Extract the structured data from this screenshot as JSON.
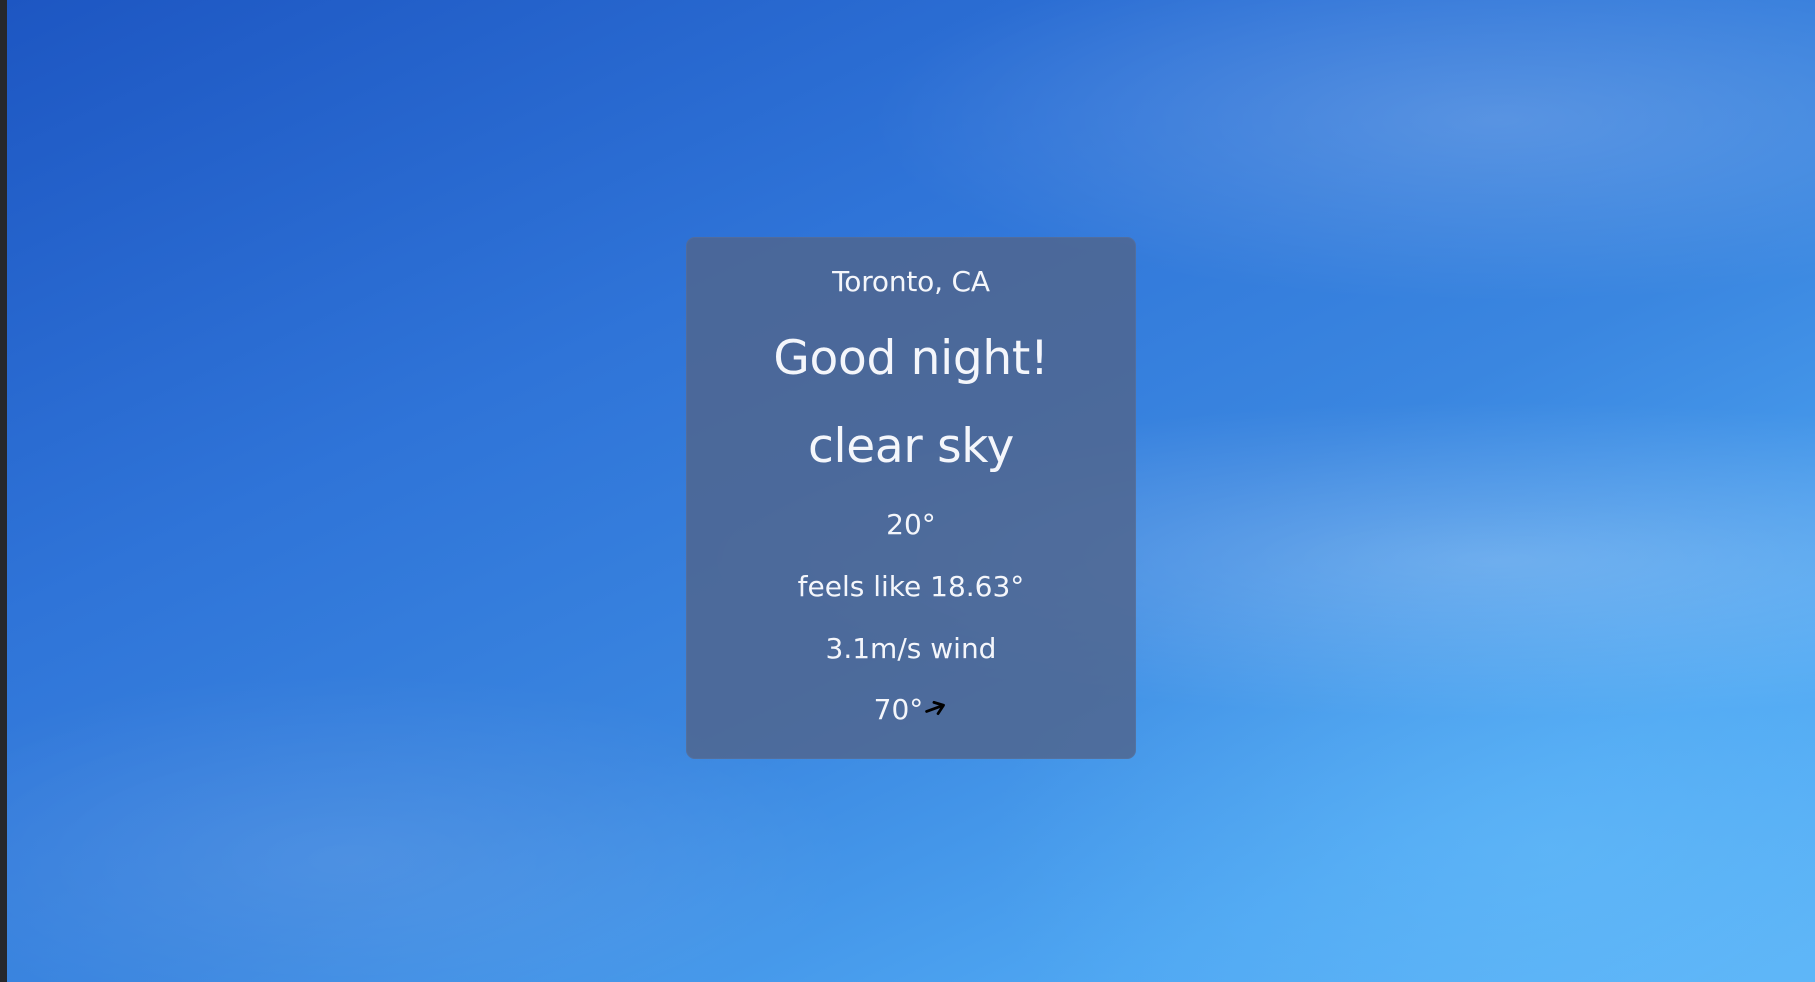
{
  "background": {
    "theme": "sky",
    "accent_colors": [
      "#1d56c2",
      "#3a86e0",
      "#5bb3f7"
    ]
  },
  "card": {
    "background_color": "#50658e",
    "location": "Toronto, CA",
    "greeting": "Good night!",
    "description": "clear sky",
    "temperature": "20°",
    "feels_like": "feels like 18.63°",
    "wind_speed": "3.1m/s wind",
    "wind_direction": "70°",
    "wind_direction_icon": "arrow-right-icon"
  }
}
